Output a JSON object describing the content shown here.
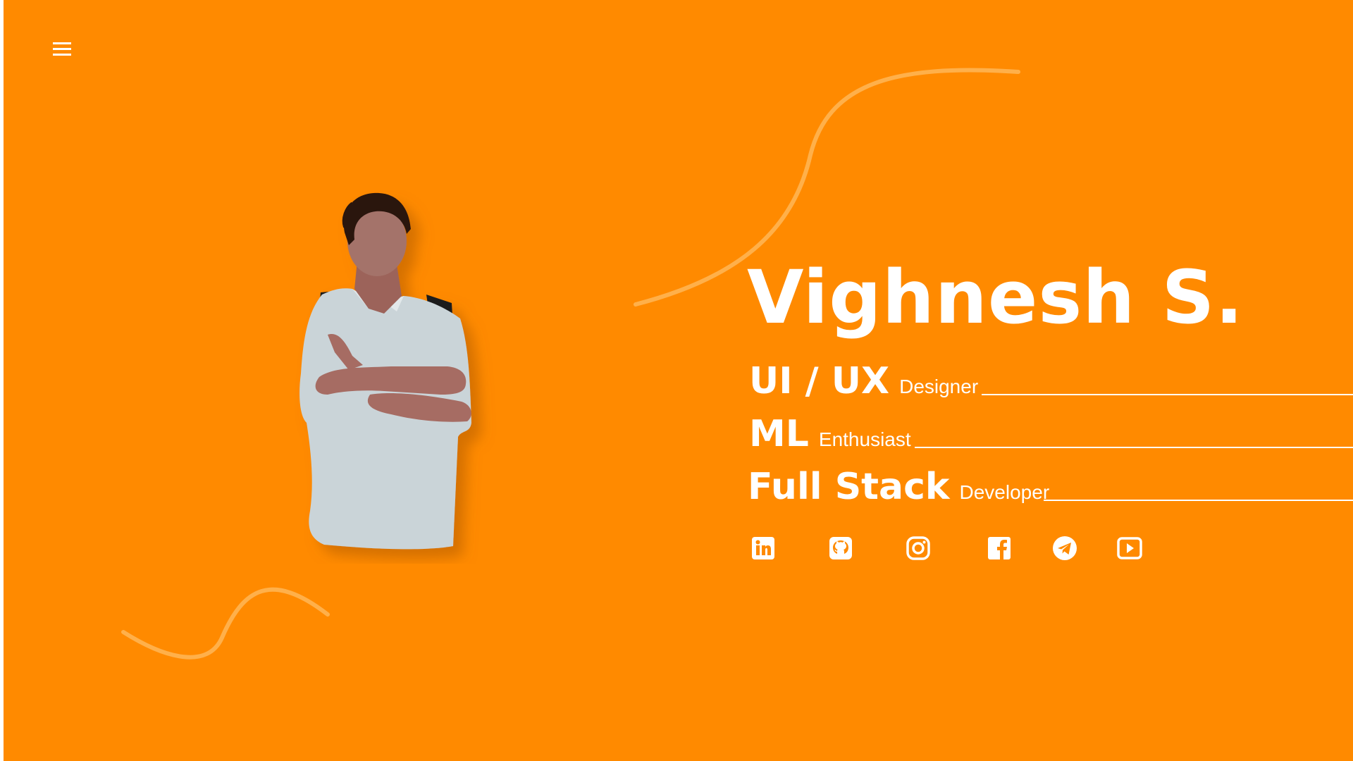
{
  "nav": {
    "menu_icon": "hamburger-menu-icon"
  },
  "hero": {
    "name": "Vighnesh S.",
    "roles": [
      {
        "strong": "UI / UX",
        "light": "Designer"
      },
      {
        "strong": "ML",
        "light": "Enthusiast"
      },
      {
        "strong": "Full Stack",
        "light": "Developer"
      }
    ]
  },
  "socials": [
    {
      "icon": "linkedin-icon"
    },
    {
      "icon": "github-icon"
    },
    {
      "icon": "instagram-icon"
    },
    {
      "icon": "facebook-icon"
    },
    {
      "icon": "telegram-icon"
    },
    {
      "icon": "youtube-icon"
    }
  ],
  "colors": {
    "background": "#ff8a00",
    "foreground": "#ffffff",
    "curve": "#ffb04a"
  }
}
